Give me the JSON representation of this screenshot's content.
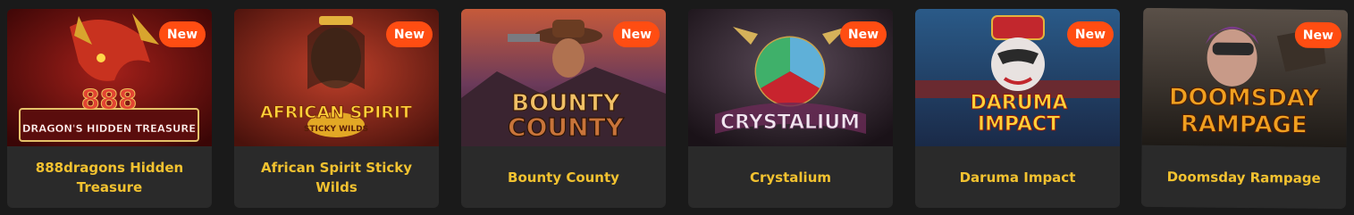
{
  "games": [
    {
      "name": "888dragons Hidden Treasure",
      "badge": "New",
      "logo_top": "888",
      "logo_bottom": "DRAGON'S HIDDEN TREASURE"
    },
    {
      "name": "African Spirit Sticky Wilds",
      "badge": "New",
      "logo_top": "AFRICAN SPIRIT",
      "logo_bottom": "STICKY WILDS"
    },
    {
      "name": "Bounty County",
      "badge": "New",
      "logo_top": "BOUNTY",
      "logo_bottom": "COUNTY"
    },
    {
      "name": "Crystalium",
      "badge": "New",
      "logo_top": "CRYSTALIUM"
    },
    {
      "name": "Daruma Impact",
      "badge": "New",
      "logo_top": "DARUMA",
      "logo_bottom": "IMPACT"
    },
    {
      "name": "Doomsday Rampage",
      "badge": "New",
      "logo_top": "DOOMSDAY",
      "logo_bottom": "RAMPAGE"
    }
  ],
  "colors": {
    "badge": "#ff4d12",
    "title": "#f2c230",
    "card": "#2a2a2a",
    "background": "#1a1a1a"
  }
}
